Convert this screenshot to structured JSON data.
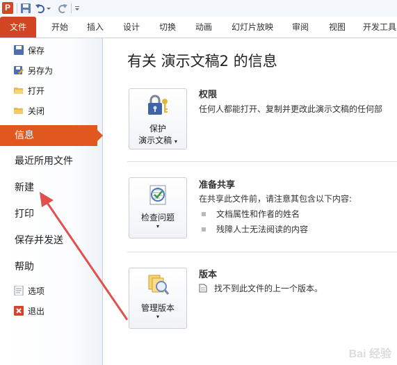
{
  "qat": {
    "app_letter": "P"
  },
  "tabs": [
    {
      "label": "文件"
    },
    {
      "label": "开始"
    },
    {
      "label": "插入"
    },
    {
      "label": "设计"
    },
    {
      "label": "切换"
    },
    {
      "label": "动画"
    },
    {
      "label": "幻灯片放映"
    },
    {
      "label": "审阅"
    },
    {
      "label": "视图"
    },
    {
      "label": "开发工具"
    }
  ],
  "nav": {
    "save": "保存",
    "save_as": "另存为",
    "open": "打开",
    "close": "关闭",
    "info": "信息",
    "recent": "最近所用文件",
    "new": "新建",
    "print": "打印",
    "save_send": "保存并发送",
    "help": "帮助",
    "options": "选项",
    "exit": "退出"
  },
  "main": {
    "title": "有关 演示文稿2 的信息",
    "permissions": {
      "button_line1": "保护",
      "button_line2": "演示文稿",
      "heading": "权限",
      "description": "任何人都能打开、复制并更改此演示文稿的任何部"
    },
    "prepare": {
      "button_label": "检查问题",
      "heading": "准备共享",
      "description": "在共享此文件前，请注意其包含以下内容:",
      "items": [
        "文档属性和作者的姓名",
        "残障人士无法阅读的内容"
      ]
    },
    "versions": {
      "button_label": "管理版本",
      "heading": "版本",
      "description": "找不到此文件的上一个版本。"
    }
  },
  "colors": {
    "file_tab": "#d14424",
    "active_nav": "#e0581f",
    "annotation_arrow": "#e0504c"
  },
  "watermark": "Bai 经验"
}
